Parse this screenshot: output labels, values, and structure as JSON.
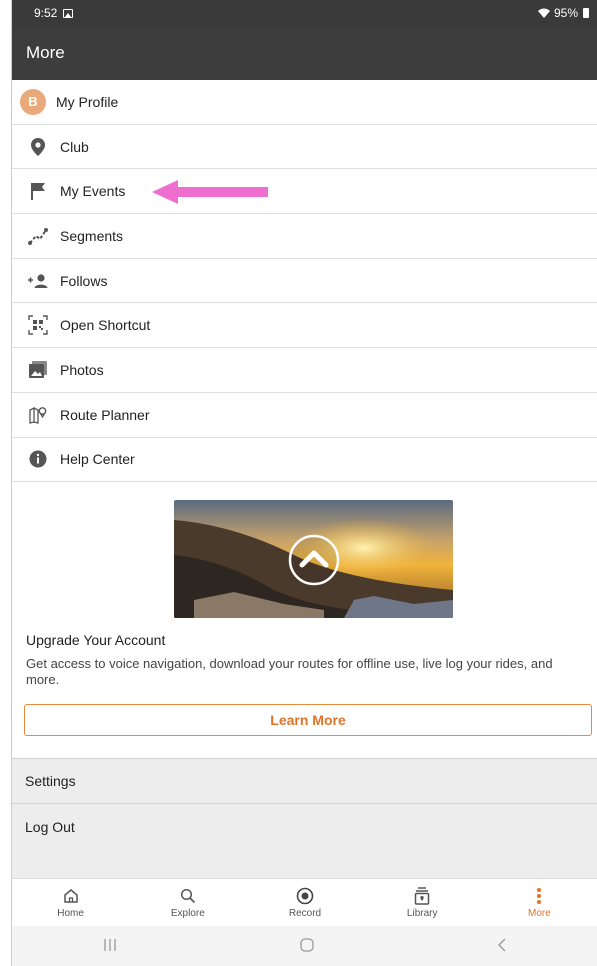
{
  "status": {
    "time": "9:52",
    "battery": "95%"
  },
  "appbar": {
    "title": "More"
  },
  "menu": [
    {
      "label": "My Profile",
      "icon": "avatar",
      "initial": "B"
    },
    {
      "label": "Club",
      "icon": "location-pin-icon"
    },
    {
      "label": "My Events",
      "icon": "flag-icon"
    },
    {
      "label": "Segments",
      "icon": "segment-icon"
    },
    {
      "label": "Follows",
      "icon": "add-person-icon"
    },
    {
      "label": "Open Shortcut",
      "icon": "qr-code-icon"
    },
    {
      "label": "Photos",
      "icon": "photo-icon"
    },
    {
      "label": "Route Planner",
      "icon": "map-pin-icon"
    },
    {
      "label": "Help Center",
      "icon": "info-icon"
    }
  ],
  "upgrade": {
    "title": "Upgrade Your Account",
    "description": "Get access to voice navigation, download your routes for offline use, live log your rides, and more.",
    "button": "Learn More"
  },
  "settings": {
    "label": "Settings"
  },
  "logout": {
    "label": "Log Out"
  },
  "bottom_nav": [
    {
      "label": "Home",
      "icon": "home-icon",
      "active": false
    },
    {
      "label": "Explore",
      "icon": "search-icon",
      "active": false
    },
    {
      "label": "Record",
      "icon": "record-icon",
      "active": false
    },
    {
      "label": "Library",
      "icon": "library-icon",
      "active": false
    },
    {
      "label": "More",
      "icon": "more-vertical-icon",
      "active": true
    }
  ],
  "colors": {
    "accent": "#E0742A",
    "arrow": "#EE6FD0",
    "appbar": "#3D3D3D"
  }
}
